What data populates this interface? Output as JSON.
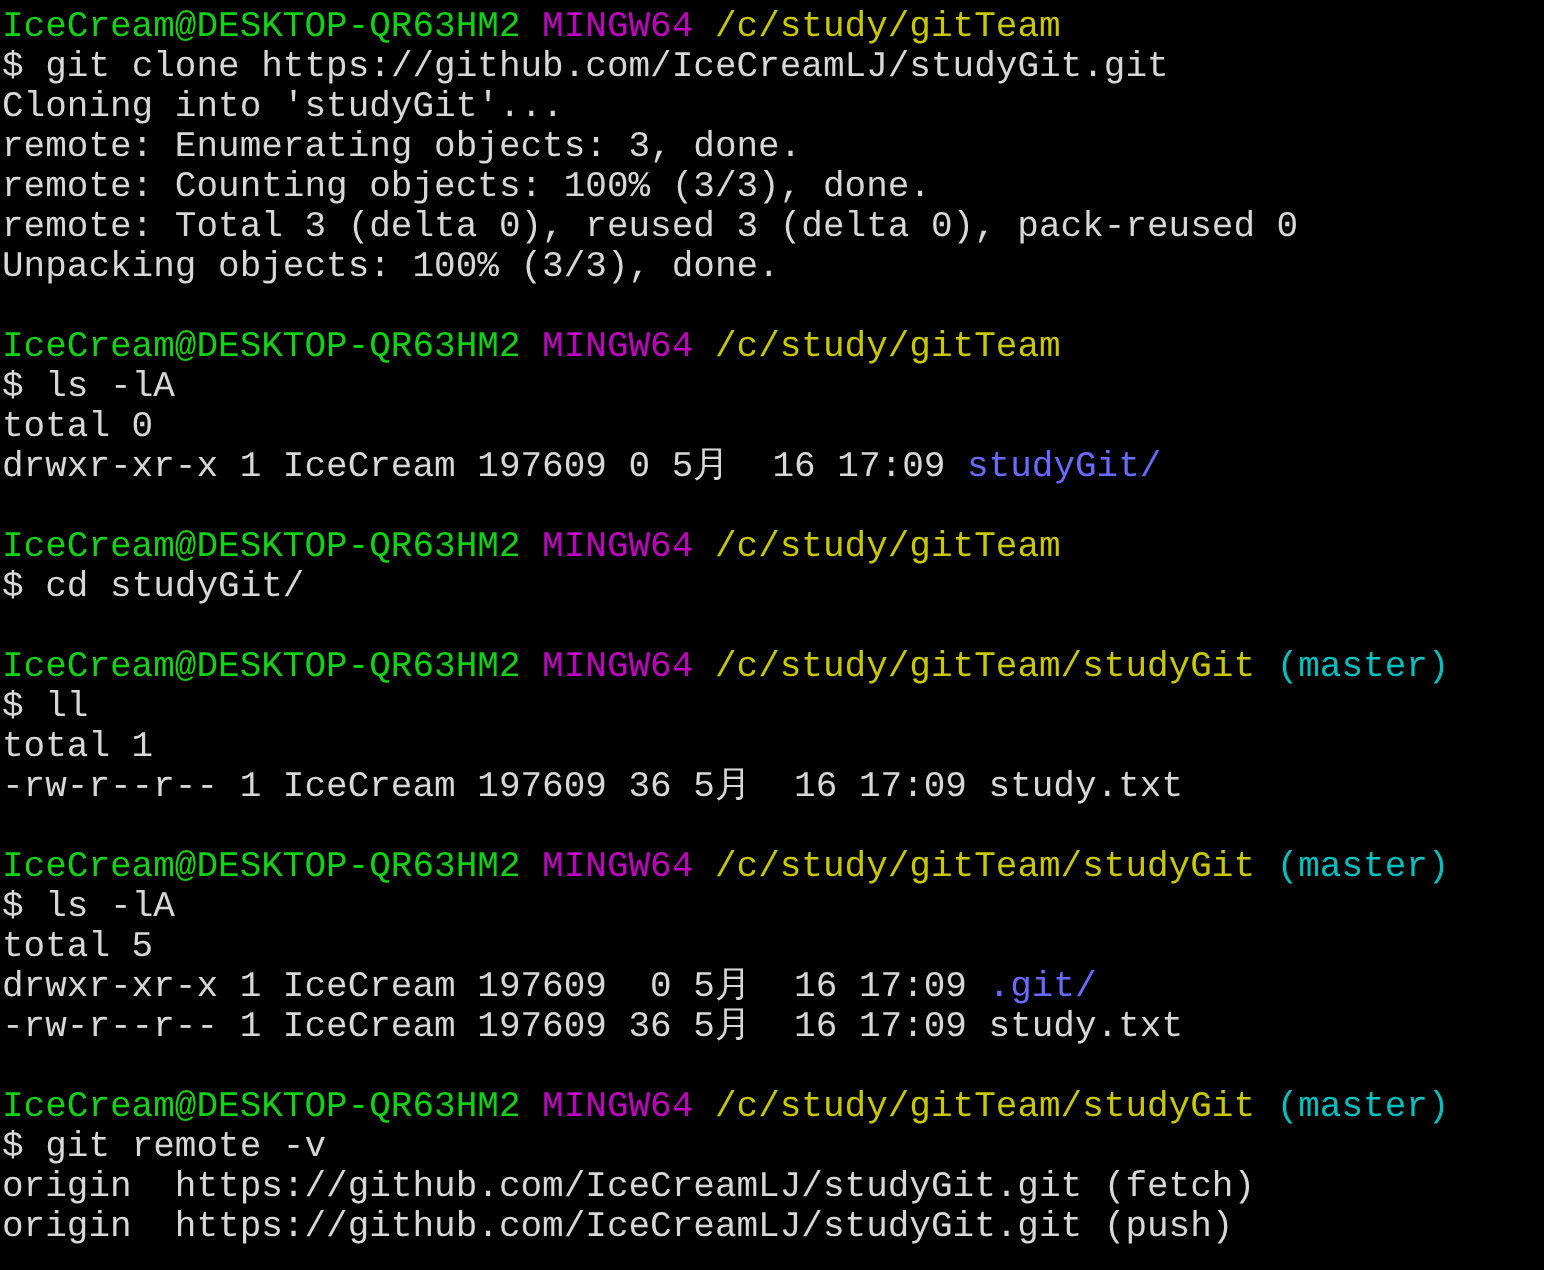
{
  "terminal": {
    "lines": [
      {
        "kind": "prompt",
        "user": "IceCream@DESKTOP-QR63HM2",
        "system": "MINGW64",
        "path": "/c/study/gitTeam"
      },
      {
        "kind": "command",
        "sign": "$",
        "text": "git clone https://github.com/IceCreamLJ/studyGit.git"
      },
      {
        "kind": "output",
        "segments": [
          {
            "kind": "plain",
            "text": "Cloning into 'studyGit'..."
          }
        ]
      },
      {
        "kind": "output",
        "segments": [
          {
            "kind": "plain",
            "text": "remote: Enumerating objects: 3, done."
          }
        ]
      },
      {
        "kind": "output",
        "segments": [
          {
            "kind": "plain",
            "text": "remote: Counting objects: 100% (3/3), done."
          }
        ]
      },
      {
        "kind": "output",
        "segments": [
          {
            "kind": "plain",
            "text": "remote: Total 3 (delta 0), reused 3 (delta 0), pack-reused 0"
          }
        ]
      },
      {
        "kind": "output",
        "segments": [
          {
            "kind": "plain",
            "text": "Unpacking objects: 100% (3/3), done."
          }
        ]
      },
      {
        "kind": "blank"
      },
      {
        "kind": "prompt",
        "user": "IceCream@DESKTOP-QR63HM2",
        "system": "MINGW64",
        "path": "/c/study/gitTeam"
      },
      {
        "kind": "command",
        "sign": "$",
        "text": "ls -lA"
      },
      {
        "kind": "output",
        "segments": [
          {
            "kind": "plain",
            "text": "total 0"
          }
        ]
      },
      {
        "kind": "output",
        "segments": [
          {
            "kind": "plain",
            "text": "drwxr-xr-x 1 IceCream 197609 0 5月  16 17:09"
          },
          {
            "kind": "dir",
            "text": "studyGit/"
          }
        ]
      },
      {
        "kind": "blank"
      },
      {
        "kind": "prompt",
        "user": "IceCream@DESKTOP-QR63HM2",
        "system": "MINGW64",
        "path": "/c/study/gitTeam"
      },
      {
        "kind": "command",
        "sign": "$",
        "text": "cd studyGit/"
      },
      {
        "kind": "blank"
      },
      {
        "kind": "prompt",
        "user": "IceCream@DESKTOP-QR63HM2",
        "system": "MINGW64",
        "path": "/c/study/gitTeam/studyGit",
        "branch": "(master)"
      },
      {
        "kind": "command",
        "sign": "$",
        "text": "ll"
      },
      {
        "kind": "output",
        "segments": [
          {
            "kind": "plain",
            "text": "total 1"
          }
        ]
      },
      {
        "kind": "output",
        "segments": [
          {
            "kind": "plain",
            "text": "-rw-r--r-- 1 IceCream 197609 36 5月  16 17:09 study.txt"
          }
        ]
      },
      {
        "kind": "blank"
      },
      {
        "kind": "prompt",
        "user": "IceCream@DESKTOP-QR63HM2",
        "system": "MINGW64",
        "path": "/c/study/gitTeam/studyGit",
        "branch": "(master)"
      },
      {
        "kind": "command",
        "sign": "$",
        "text": "ls -lA"
      },
      {
        "kind": "output",
        "segments": [
          {
            "kind": "plain",
            "text": "total 5"
          }
        ]
      },
      {
        "kind": "output",
        "segments": [
          {
            "kind": "plain",
            "text": "drwxr-xr-x 1 IceCream 197609  0 5月  16 17:09"
          },
          {
            "kind": "dir",
            "text": ".git/"
          }
        ]
      },
      {
        "kind": "output",
        "segments": [
          {
            "kind": "plain",
            "text": "-rw-r--r-- 1 IceCream 197609 36 5月  16 17:09 study.txt"
          }
        ]
      },
      {
        "kind": "blank"
      },
      {
        "kind": "prompt",
        "user": "IceCream@DESKTOP-QR63HM2",
        "system": "MINGW64",
        "path": "/c/study/gitTeam/studyGit",
        "branch": "(master)"
      },
      {
        "kind": "command",
        "sign": "$",
        "text": "git remote -v"
      },
      {
        "kind": "output",
        "segments": [
          {
            "kind": "plain",
            "text": "origin  https://github.com/IceCreamLJ/studyGit.git (fetch)"
          }
        ]
      },
      {
        "kind": "output",
        "segments": [
          {
            "kind": "plain",
            "text": "origin  https://github.com/IceCreamLJ/studyGit.git (push)"
          }
        ]
      }
    ]
  }
}
